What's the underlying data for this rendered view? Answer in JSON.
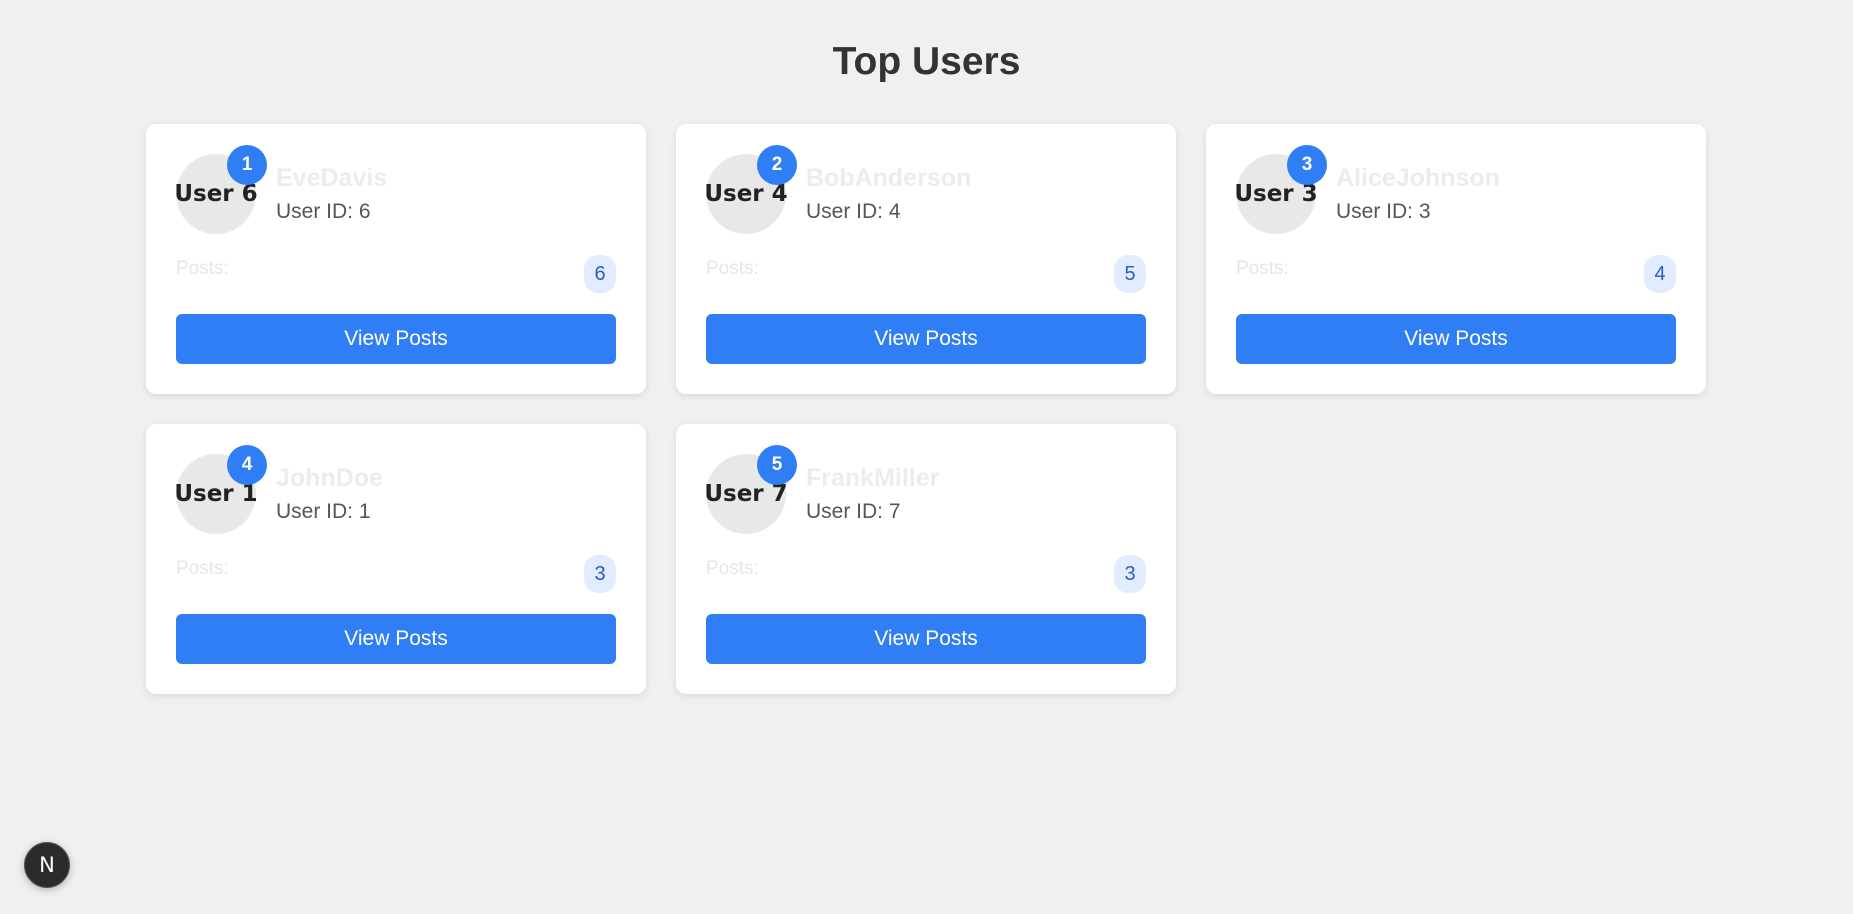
{
  "page": {
    "title": "Top Users"
  },
  "users": [
    {
      "rank": "1",
      "avatar_label": "User 6",
      "name": "EveDavis",
      "user_id_text": "User ID: 6",
      "posts_label": "Posts:",
      "posts_count": "6",
      "button_label": "View Posts"
    },
    {
      "rank": "2",
      "avatar_label": "User 4",
      "name": "BobAnderson",
      "user_id_text": "User ID: 4",
      "posts_label": "Posts:",
      "posts_count": "5",
      "button_label": "View Posts"
    },
    {
      "rank": "3",
      "avatar_label": "User 3",
      "name": "AliceJohnson",
      "user_id_text": "User ID: 3",
      "posts_label": "Posts:",
      "posts_count": "4",
      "button_label": "View Posts"
    },
    {
      "rank": "4",
      "avatar_label": "User 1",
      "name": "JohnDoe",
      "user_id_text": "User ID: 1",
      "posts_label": "Posts:",
      "posts_count": "3",
      "button_label": "View Posts"
    },
    {
      "rank": "5",
      "avatar_label": "User 7",
      "name": "FrankMiller",
      "user_id_text": "User ID: 7",
      "posts_label": "Posts:",
      "posts_count": "3",
      "button_label": "View Posts"
    }
  ],
  "dev_indicator": {
    "label": "N",
    "icon": "nextjs-logo-icon"
  },
  "colors": {
    "background": "#f0f0f0",
    "accent": "#2f7ef5",
    "card": "#ffffff",
    "count_badge_bg": "#e1ecff"
  }
}
